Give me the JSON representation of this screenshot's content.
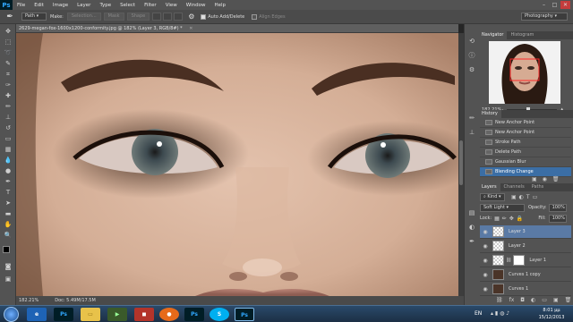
{
  "menubar": {
    "logo": "Ps",
    "items": [
      "File",
      "Edit",
      "Image",
      "Layer",
      "Type",
      "Select",
      "Filter",
      "View",
      "Window",
      "Help"
    ]
  },
  "options": {
    "tool_mode": "Path",
    "make_label": "Make:",
    "selection_label": "Selection...",
    "mask_label": "Mask",
    "shape_label": "Shape",
    "auto_add_delete": "Auto Add/Delete",
    "align_edges": "Align Edges",
    "workspace": "Photography"
  },
  "document": {
    "tab_title": "2629-megan-fox-1600x1200-conformity.jpg @ 182% (Layer 3, RGB/8#) *",
    "zoom": "182.21%",
    "doc_size": "Doc: 5.49M/17.5M"
  },
  "navigator": {
    "tabs": [
      "Navigator",
      "Histogram"
    ],
    "zoom": "182.21%"
  },
  "history": {
    "tab": "History",
    "items": [
      "New Anchor Point",
      "New Anchor Point",
      "Stroke Path",
      "Delete Path",
      "Gaussian Blur",
      "Blending Change"
    ]
  },
  "layers_panel": {
    "tabs": [
      "Layers",
      "Channels",
      "Paths"
    ],
    "kind_label": "Kind",
    "blend_mode": "Soft Light",
    "opacity_label": "Opacity:",
    "opacity": "100%",
    "lock_label": "Lock:",
    "fill_label": "Fill:",
    "fill": "100%",
    "layers": [
      "Layer 3",
      "Layer 2",
      "Layer 1",
      "Curves 1 copy",
      "Curves 1"
    ]
  },
  "taskbar": {
    "language": "EN",
    "time": "8:01 μμ",
    "date": "15/12/2013",
    "apps": [
      "Ps",
      "Ps",
      "Ps"
    ]
  },
  "colors": {
    "accent": "#3b6ea5",
    "ps_blue": "#31a8ff",
    "panel_bg": "#535353"
  }
}
